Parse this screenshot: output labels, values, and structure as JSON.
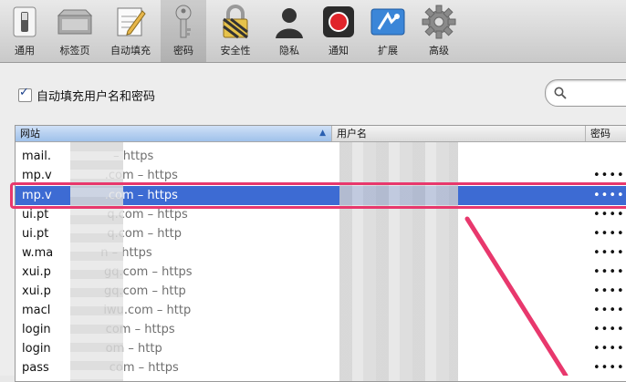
{
  "toolbar": {
    "items": [
      {
        "label": "通用",
        "icon": "switch-icon"
      },
      {
        "label": "标签页",
        "icon": "tabs-icon"
      },
      {
        "label": "自动填充",
        "icon": "pencil-form-icon"
      },
      {
        "label": "密码",
        "icon": "key-icon"
      },
      {
        "label": "安全性",
        "icon": "lock-icon"
      },
      {
        "label": "隐私",
        "icon": "person-icon"
      },
      {
        "label": "通知",
        "icon": "record-icon"
      },
      {
        "label": "扩展",
        "icon": "puzzle-icon"
      },
      {
        "label": "高级",
        "icon": "gear-icon"
      }
    ],
    "active_index": 3
  },
  "autofill": {
    "label": "自动填充用户名和密码",
    "checked": true
  },
  "table": {
    "columns": [
      "网站",
      "用户名",
      "密码"
    ],
    "rows": [
      {
        "site": "mail.",
        "proto": " – https",
        "password": ""
      },
      {
        "site": "mp.v",
        "proto": ".com – https",
        "password": "•••••"
      },
      {
        "site": "mp.v",
        "proto": ".com – https",
        "password": "•••••"
      },
      {
        "site": "ui.pt",
        "proto": "q.com – https",
        "password": "•••••"
      },
      {
        "site": "ui.pt",
        "proto": "q.com – http",
        "password": "•••••"
      },
      {
        "site": "w.ma",
        "proto": "n – https",
        "password": "•••••"
      },
      {
        "site": "xui.p",
        "proto": "gq.com – https",
        "password": "•••••"
      },
      {
        "site": "xui.p",
        "proto": "gq.com – http",
        "password": "•••••"
      },
      {
        "site": "macl",
        "proto": "iwu.com – http",
        "password": "•••••"
      },
      {
        "site": "login",
        "proto": "com – https",
        "password": "•••••"
      },
      {
        "site": "login",
        "proto": "om – http",
        "password": "•••••"
      },
      {
        "site": "pass",
        "proto": "com – https",
        "password": "•••••"
      }
    ],
    "selected_index": 2
  },
  "colors": {
    "selection": "#3d6bd3",
    "annotation": "#e8386d"
  }
}
